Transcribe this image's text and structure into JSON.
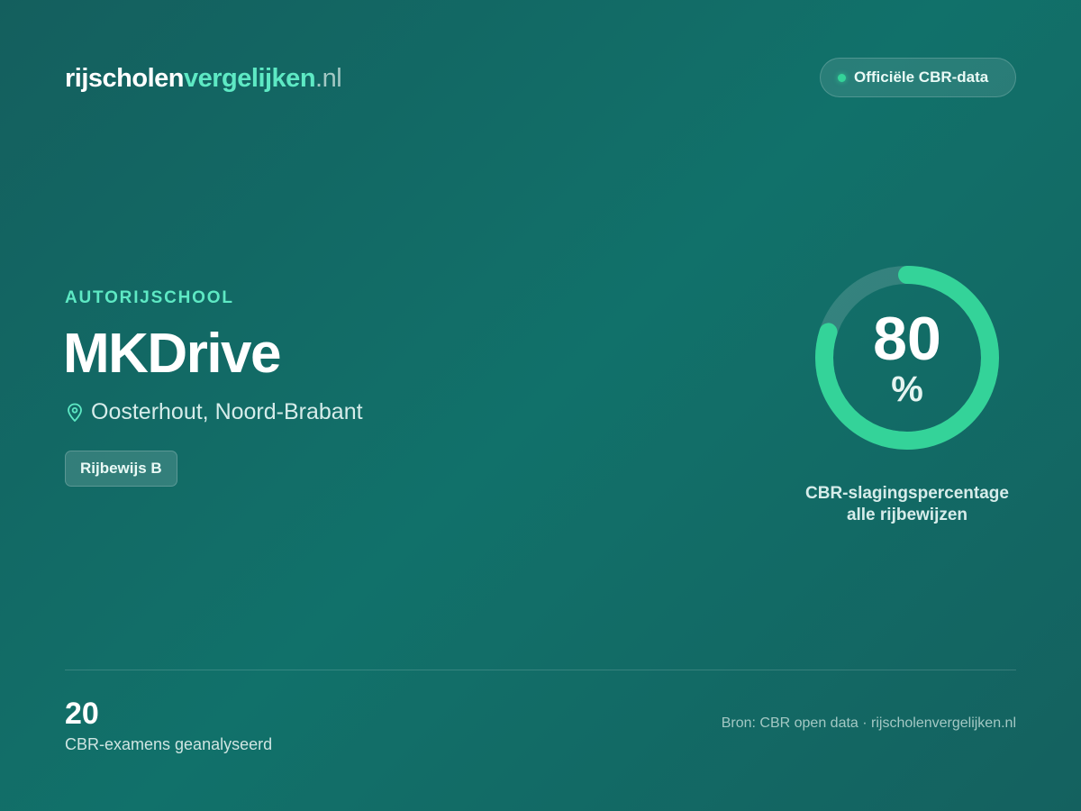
{
  "header": {
    "logo_part1": "rijscholen",
    "logo_part2": "vergelijken",
    "logo_part3": ".nl",
    "badge_text": "Officiële CBR-data"
  },
  "school": {
    "category": "AUTORIJSCHOOL",
    "name": "MKDrive",
    "location": "Oosterhout, Noord-Brabant",
    "license": "Rijbewijs B",
    "location_icon": "map-pin-icon"
  },
  "pass_rate": {
    "value": "80",
    "unit": "%",
    "fraction": 0.8,
    "caption_line1": "CBR-slagingspercentage",
    "caption_line2": "alle rijbewijzen"
  },
  "footer": {
    "exams_count": "20",
    "exams_label": "CBR-examens geanalyseerd",
    "source": "Bron: CBR open data · rijscholenvergelijken.nl"
  },
  "colors": {
    "accent": "#5ee9c4",
    "ring": "#34d399",
    "background": "#11716a"
  }
}
